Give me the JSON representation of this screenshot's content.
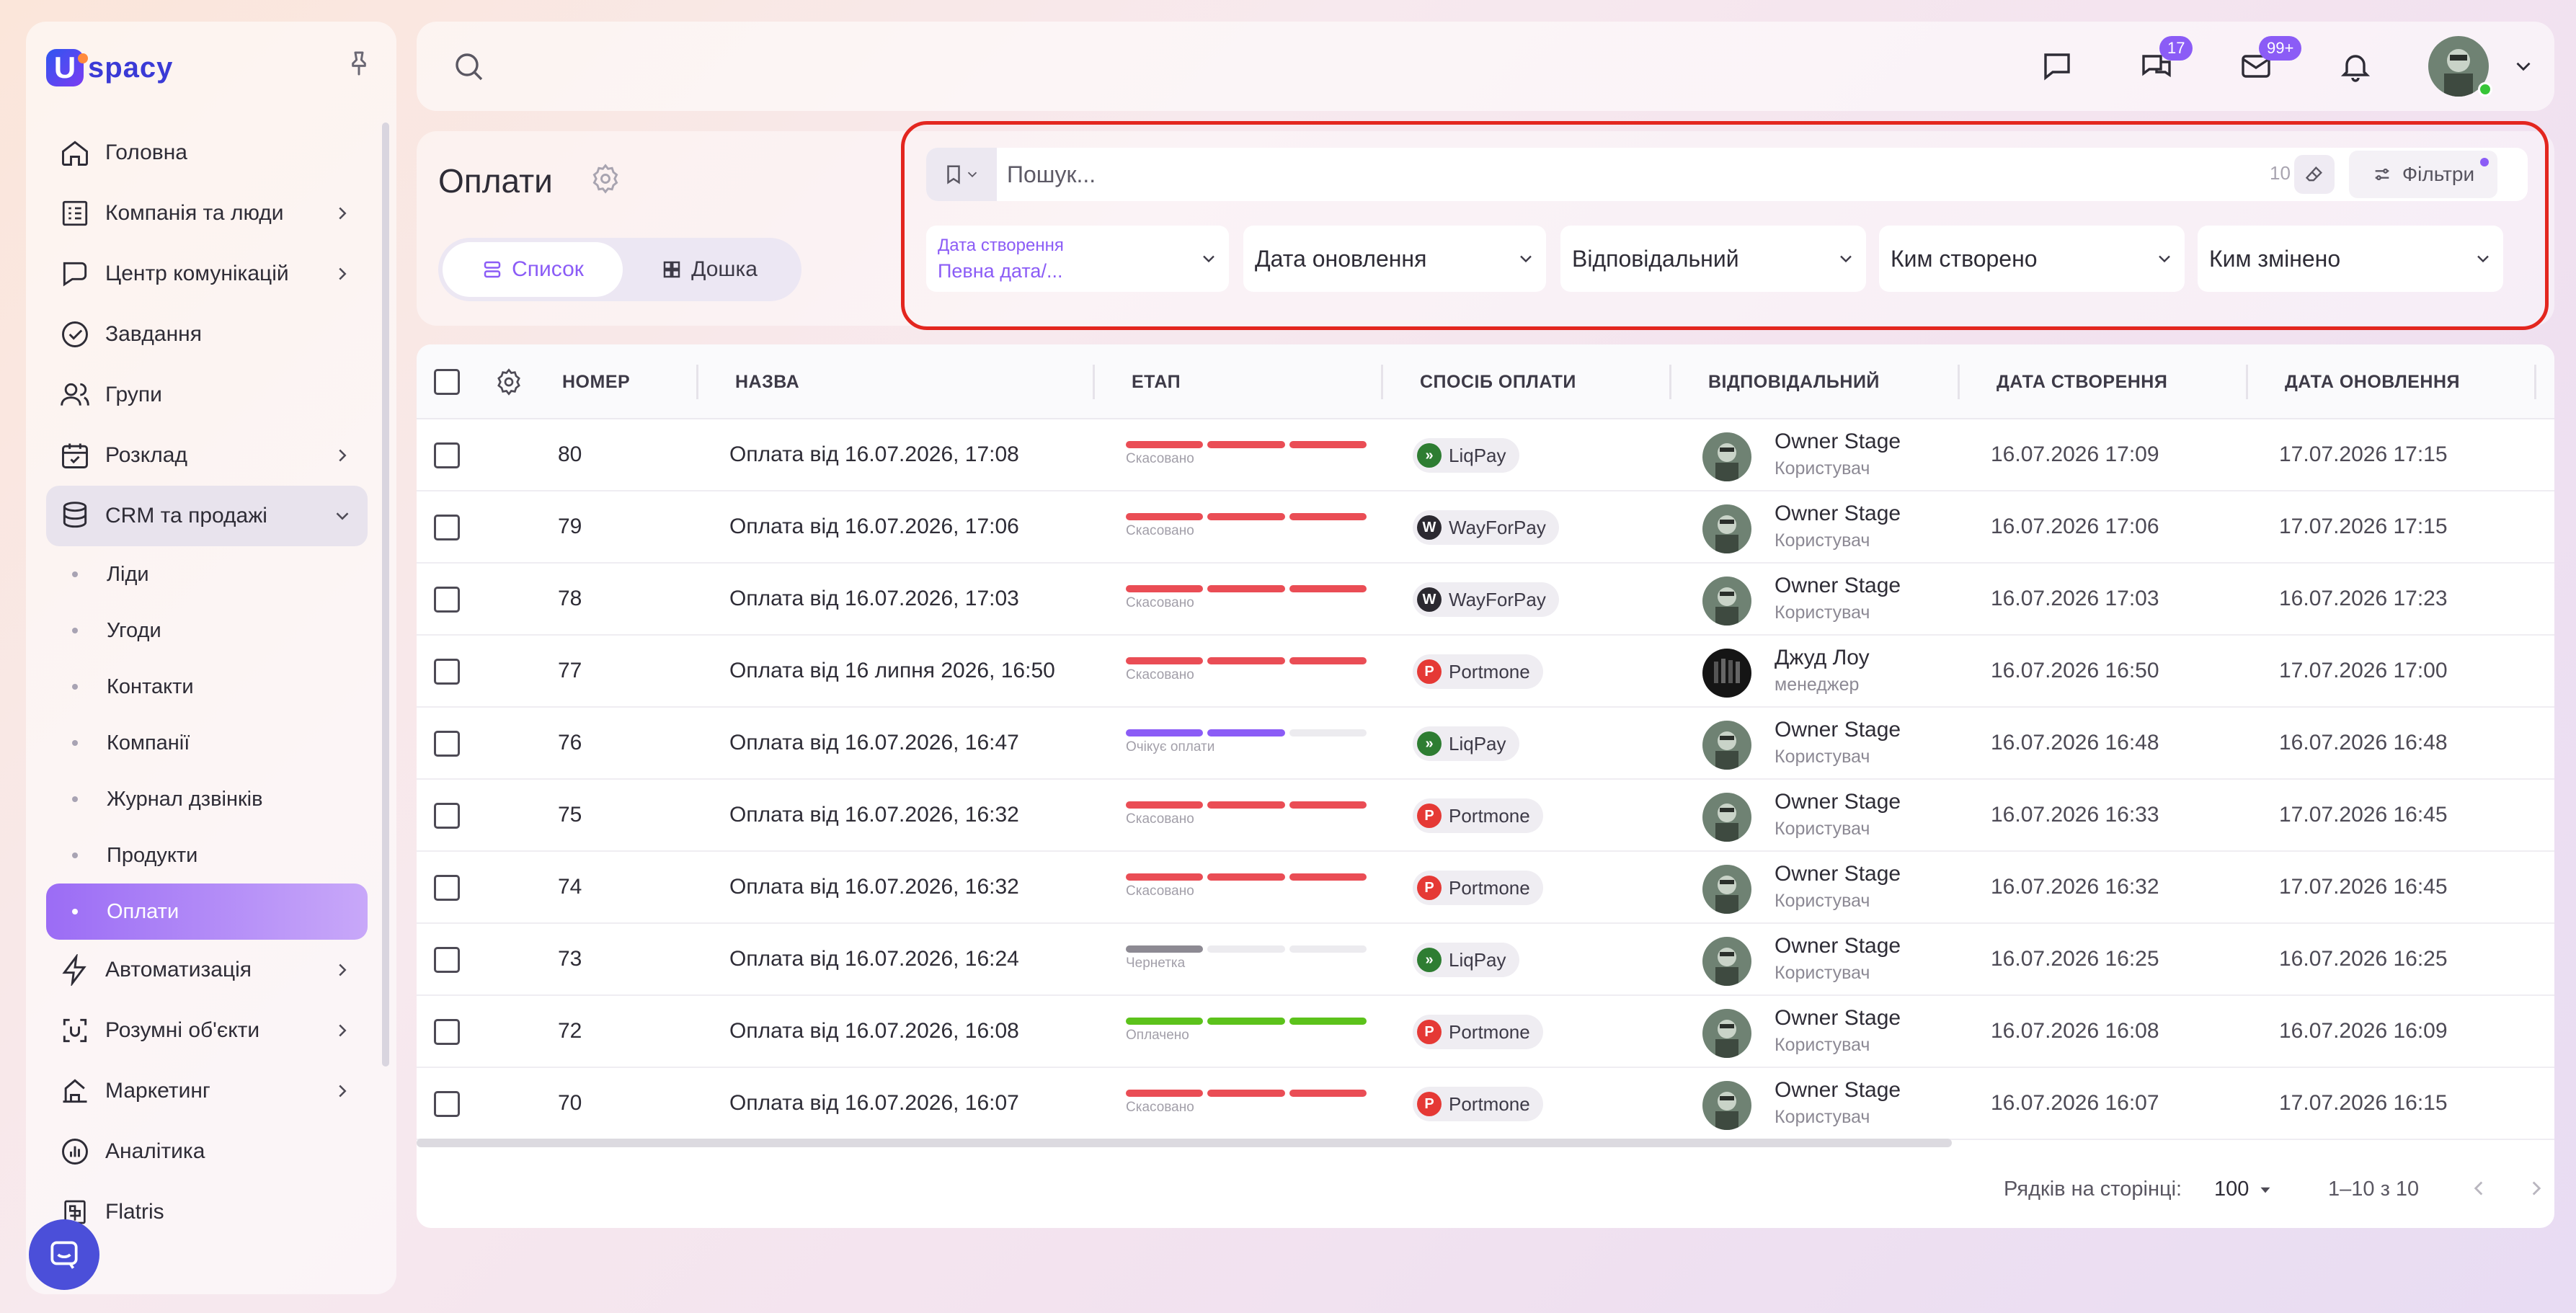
{
  "brand": {
    "logo_letter": "U",
    "logo_text": "spacy",
    "brand_color": "#3a3ad6",
    "accent": "#8b5cf6"
  },
  "sidebar": {
    "items": [
      {
        "label": "Головна",
        "icon": "home-icon"
      },
      {
        "label": "Компанія та люди",
        "icon": "org-icon"
      },
      {
        "label": "Центр комунікацій",
        "icon": "communications-icon"
      },
      {
        "label": "Завдання",
        "icon": "check-circle-icon"
      },
      {
        "label": "Групи",
        "icon": "users-icon"
      },
      {
        "label": "Розклад",
        "icon": "calendar-icon"
      },
      {
        "label": "CRM та продажі",
        "icon": "database-icon"
      },
      {
        "label": "Автоматизація",
        "icon": "lightning-icon"
      },
      {
        "label": "Розумні об'єкти",
        "icon": "smart-object-icon"
      },
      {
        "label": "Маркетинг",
        "icon": "marketing-icon"
      },
      {
        "label": "Аналітика",
        "icon": "analytics-icon"
      },
      {
        "label": "Flatris",
        "icon": "flatris-icon"
      }
    ],
    "crm_sub": [
      "Ліди",
      "Угоди",
      "Контакти",
      "Компанії",
      "Журнал дзвінків",
      "Продукти",
      "Оплати"
    ]
  },
  "topbar": {
    "chat_badge": "17",
    "mail_badge": "99+"
  },
  "header": {
    "title": "Оплати",
    "view_list": "Список",
    "view_board": "Дошка",
    "search_placeholder": "Пошук...",
    "count": "10",
    "filters_label": "Фільтри",
    "dropdowns": {
      "created_label": "Дата створення",
      "created_value": "Певна дата/...",
      "updated": "Дата оновлення",
      "responsible": "Відповідальний",
      "created_by": "Ким створено",
      "changed_by": "Ким змінено"
    }
  },
  "table": {
    "columns": {
      "number": "НОМЕР",
      "name": "НАЗВА",
      "stage": "ЕТАП",
      "payment": "СПОСІБ ОПЛАТИ",
      "responsible": "ВІДПОВІДАЛЬНИЙ",
      "created": "ДАТА СТВОРЕННЯ",
      "updated": "ДАТА ОНОВЛЕННЯ"
    },
    "stage_colors": {
      "canceled": "#ea4d55",
      "waiting": "#8b5cf6",
      "draft": "#8d8a93",
      "paid": "#5cc21b"
    },
    "rows": [
      {
        "num": "80",
        "name": "Оплата від 16.07.2026, 17:08",
        "stage": "Скасовано",
        "stage_type": "canceled",
        "stage_fill": 3,
        "pay": "LiqPay",
        "pay_type": "liqpay",
        "resp": "Owner Stage",
        "role": "Користувач",
        "created": "16.07.2026 17:09",
        "updated": "17.07.2026 17:15"
      },
      {
        "num": "79",
        "name": "Оплата від 16.07.2026, 17:06",
        "stage": "Скасовано",
        "stage_type": "canceled",
        "stage_fill": 3,
        "pay": "WayForPay",
        "pay_type": "wayforpay",
        "resp": "Owner Stage",
        "role": "Користувач",
        "created": "16.07.2026 17:06",
        "updated": "17.07.2026 17:15"
      },
      {
        "num": "78",
        "name": "Оплата від 16.07.2026, 17:03",
        "stage": "Скасовано",
        "stage_type": "canceled",
        "stage_fill": 3,
        "pay": "WayForPay",
        "pay_type": "wayforpay",
        "resp": "Owner Stage",
        "role": "Користувач",
        "created": "16.07.2026 17:03",
        "updated": "16.07.2026 17:23"
      },
      {
        "num": "77",
        "name": "Оплата від 16 липня 2026, 16:50",
        "stage": "Скасовано",
        "stage_type": "canceled",
        "stage_fill": 3,
        "pay": "Portmone",
        "pay_type": "portmone",
        "resp": "Джуд Лоу",
        "role": "менеджер",
        "created": "16.07.2026 16:50",
        "updated": "17.07.2026 17:00"
      },
      {
        "num": "76",
        "name": "Оплата від 16.07.2026, 16:47",
        "stage": "Очікує оплати",
        "stage_type": "waiting",
        "stage_fill": 2,
        "pay": "LiqPay",
        "pay_type": "liqpay",
        "resp": "Owner Stage",
        "role": "Користувач",
        "created": "16.07.2026 16:48",
        "updated": "16.07.2026 16:48"
      },
      {
        "num": "75",
        "name": "Оплата від 16.07.2026, 16:32",
        "stage": "Скасовано",
        "stage_type": "canceled",
        "stage_fill": 3,
        "pay": "Portmone",
        "pay_type": "portmone",
        "resp": "Owner Stage",
        "role": "Користувач",
        "created": "16.07.2026 16:33",
        "updated": "17.07.2026 16:45"
      },
      {
        "num": "74",
        "name": "Оплата від 16.07.2026, 16:32",
        "stage": "Скасовано",
        "stage_type": "canceled",
        "stage_fill": 3,
        "pay": "Portmone",
        "pay_type": "portmone",
        "resp": "Owner Stage",
        "role": "Користувач",
        "created": "16.07.2026 16:32",
        "updated": "17.07.2026 16:45"
      },
      {
        "num": "73",
        "name": "Оплата від 16.07.2026, 16:24",
        "stage": "Чернетка",
        "stage_type": "draft",
        "stage_fill": 1,
        "pay": "LiqPay",
        "pay_type": "liqpay",
        "resp": "Owner Stage",
        "role": "Користувач",
        "created": "16.07.2026 16:25",
        "updated": "16.07.2026 16:25"
      },
      {
        "num": "72",
        "name": "Оплата від 16.07.2026, 16:08",
        "stage": "Оплачено",
        "stage_type": "paid",
        "stage_fill": 3,
        "pay": "Portmone",
        "pay_type": "portmone",
        "resp": "Owner Stage",
        "role": "Користувач",
        "created": "16.07.2026 16:08",
        "updated": "16.07.2026 16:09"
      },
      {
        "num": "70",
        "name": "Оплата від 16.07.2026, 16:07",
        "stage": "Скасовано",
        "stage_type": "canceled",
        "stage_fill": 3,
        "pay": "Portmone",
        "pay_type": "portmone",
        "resp": "Owner Stage",
        "role": "Користувач",
        "created": "16.07.2026 16:07",
        "updated": "17.07.2026 16:15"
      }
    ]
  },
  "footer": {
    "rows_per_page_label": "Рядків на сторінці:",
    "rows_per_page": "100",
    "range": "1–10 з 10"
  }
}
